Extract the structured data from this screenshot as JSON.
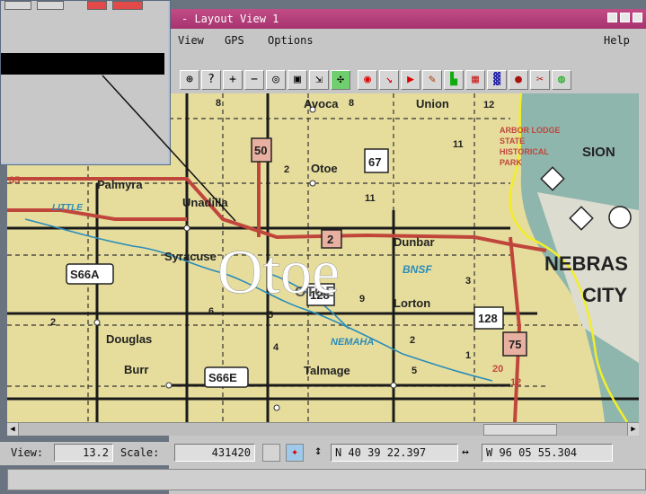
{
  "window": {
    "title": "Layout View 1"
  },
  "menu": {
    "items": [
      "View",
      "GPS",
      "Options"
    ],
    "help": "Help"
  },
  "map": {
    "big_label": "Otoe",
    "places": {
      "avoca": "Avoca",
      "union": "Union",
      "palmyra": "Palmyra",
      "otoe": "Otoe",
      "unadilla": "Unadilla",
      "syracuse": "Syracuse",
      "dunbar": "Dunbar",
      "lorton": "Lorton",
      "douglas": "Douglas",
      "burr": "Burr",
      "talmage": "Talmage",
      "nebraska": "NEBRAS",
      "city": "CITY",
      "sion": "SION",
      "nemaha": "NEMAHA",
      "bnsf": "BNSF",
      "otoe_county": "OTOE",
      "little": "LITTLE",
      "arbor": "ARBOR LODGE",
      "state": "STATE",
      "historical": "HISTORICAL",
      "park": "PARK"
    },
    "shields": {
      "s50": "50",
      "s67": "67",
      "s2": "2",
      "s128a": "128",
      "s128b": "128",
      "s75": "75",
      "s66a": "S66A",
      "s66e": "S66E"
    },
    "section_numbers": [
      "8",
      "7",
      "8",
      "2",
      "11",
      "12",
      "35",
      "11",
      "5",
      "6",
      "4",
      "9",
      "2",
      "1",
      "20",
      "12",
      "3",
      "2",
      "5"
    ]
  },
  "statusbar": {
    "view_label": "View:",
    "view_value": "13.2",
    "scale_label": "Scale:",
    "scale_value": "431420",
    "lat_value": "N 40 39 22.397",
    "lon_value": "W 96 05 55.304"
  },
  "colors": {
    "title": "#b03c78",
    "map_bg": "#e6dd9c",
    "road_red": "#c0463c",
    "river": "#2a8cba",
    "gps_track": "#f2ee2a"
  }
}
